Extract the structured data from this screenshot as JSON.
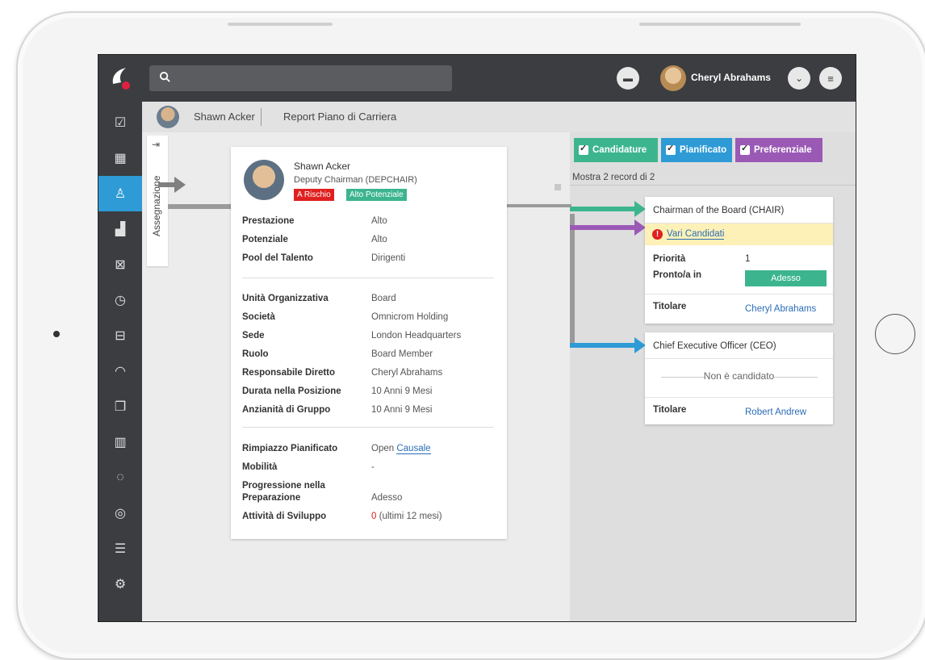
{
  "topbar": {
    "search_placeholder": "",
    "user_name": "Cheryl Abrahams"
  },
  "sidebar": {
    "items": [
      {
        "icon": "checklist-icon"
      },
      {
        "icon": "calendar-icon"
      },
      {
        "icon": "people-icon",
        "active": true
      },
      {
        "icon": "org-chart-icon"
      },
      {
        "icon": "calendar-x-icon"
      },
      {
        "icon": "clock-icon"
      },
      {
        "icon": "book-icon"
      },
      {
        "icon": "gauge-icon"
      },
      {
        "icon": "documents-icon"
      },
      {
        "icon": "bar-chart-icon"
      },
      {
        "icon": "chat-icon"
      },
      {
        "icon": "globe-icon"
      },
      {
        "icon": "list-icon"
      },
      {
        "icon": "gear-icon"
      }
    ]
  },
  "breadcrumb": {
    "name": "Shawn Acker",
    "title": "Report Piano di Carriera"
  },
  "vertical_tab": {
    "label": "Assegnazione"
  },
  "profile": {
    "name": "Shawn Acker",
    "role": "Deputy Chairman (DEPCHAIR)",
    "badge_risk": "A Rischio",
    "badge_potential": "Alto Potenziale",
    "section1": [
      {
        "k": "Prestazione",
        "v": "Alto"
      },
      {
        "k": "Potenziale",
        "v": "Alto"
      },
      {
        "k": "Pool del Talento",
        "v": "Dirigenti"
      }
    ],
    "section2": [
      {
        "k": "Unità Organizzativa",
        "v": "Board"
      },
      {
        "k": "Società",
        "v": "Omnicrom Holding"
      },
      {
        "k": "Sede",
        "v": "London Headquarters"
      },
      {
        "k": "Ruolo",
        "v": "Board Member"
      },
      {
        "k": "Responsabile Diretto",
        "v": "Cheryl Abrahams"
      },
      {
        "k": "Durata nella Posizione",
        "v": "10 Anni 9 Mesi"
      },
      {
        "k": "Anzianità di Gruppo",
        "v": "10 Anni 9 Mesi"
      }
    ],
    "section3": {
      "replacement_k": "Rimpiazzo Pianificato",
      "replacement_v": "Open",
      "replacement_link": "Causale",
      "mobility_k": "Mobilità",
      "mobility_v": "-",
      "prep_k1": "Progressione nella",
      "prep_k2": "Preparazione",
      "prep_v": "Adesso",
      "dev_k": "Attività di Sviluppo",
      "dev_count": "0",
      "dev_suffix": "(ultimi 12 mesi)"
    }
  },
  "filters": {
    "candidature": "Candidature",
    "pianificato": "Pianificato",
    "preferenziale": "Preferenziale",
    "records": "Mostra 2 record di 2"
  },
  "positions": [
    {
      "title": "Chairman of the Board (CHAIR)",
      "warning": "Vari Candidati",
      "priority_k": "Priorità",
      "priority_v": "1",
      "ready_k": "Pronto/a in",
      "ready_v": "Adesso",
      "holder_k": "Titolare",
      "holder_v": "Cheryl Abrahams"
    },
    {
      "title": "Chief Executive Officer (CEO)",
      "status": "Non è candidato",
      "holder_k": "Titolare",
      "holder_v": "Robert Andrew"
    }
  ],
  "colors": {
    "green": "#3cb58f",
    "blue": "#2e9bd6",
    "purple": "#9b59b6",
    "red": "#e02020",
    "dark": "#3b3d40"
  }
}
